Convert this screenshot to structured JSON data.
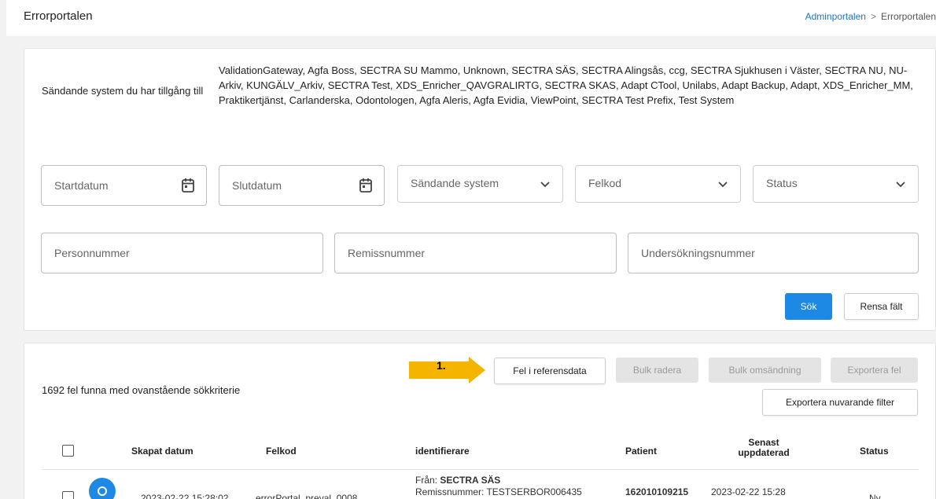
{
  "header": {
    "title": "Errorportalen",
    "breadcrumb": {
      "link": "Adminportalen",
      "separator": ">",
      "current": "Errorportalen"
    }
  },
  "systems": {
    "label": "Sändande system du har tillgång till",
    "list": "ValidationGateway, Agfa Boss, SECTRA SU Mammo, Unknown, SECTRA SÄS, SECTRA Alingsås, ccg, SECTRA Sjukhusen i Väster, SECTRA NU, NU-Arkiv, KUNGÄLV_Arkiv, SECTRA Test, XDS_Enricher_QAVGRALIRTG, SECTRA SKAS, Adapt CTool, Unilabs, Adapt Backup, Adapt, XDS_Enricher_MM, Praktikertjänst, Carlanderska, Odontologen, Agfa Aleris, Agfa Evidia, ViewPoint, SECTRA Test Prefix, Test System"
  },
  "filters": {
    "start_date": "Startdatum",
    "end_date": "Slutdatum",
    "sending_system": "Sändande system",
    "error_code": "Felkod",
    "status": "Status",
    "personal_number": "Personnummer",
    "referral_number": "Remissnummer",
    "exam_number": "Undersökningsnummer",
    "search_button": "Sök",
    "clear_button": "Rensa fält"
  },
  "results": {
    "annotation": "1.",
    "ref_error_button": "Fel i referensdata",
    "bulk_delete_button": "Bulk radera",
    "bulk_resend_button": "Bulk omsändning",
    "export_errors_button": "Exportera fel",
    "export_filter_button": "Exportera nuvarande filter",
    "count_text": "1692 fel funna med ovanstående sökkriterie",
    "columns": {
      "created": "Skapat datum",
      "error_code": "Felkod",
      "identifiers": "identifierare",
      "patient": "Patient",
      "updated_line1": "Senast",
      "updated_line2": "uppdaterad",
      "status": "Status"
    },
    "rows": [
      {
        "created": "2023-02-22 15:28:02",
        "error_code": "errorPortal_preval_0008",
        "from_label": "Från:",
        "from_value": "SECTRA SÄS",
        "referral": "Remissnummer: TESTSERBOR006435",
        "patient": "162010109215",
        "updated": "2023-02-22 15:28",
        "status": "Ny"
      }
    ]
  },
  "colors": {
    "primary": "#1e88e5",
    "arrow": "#f5b400",
    "link": "#1976d2"
  }
}
